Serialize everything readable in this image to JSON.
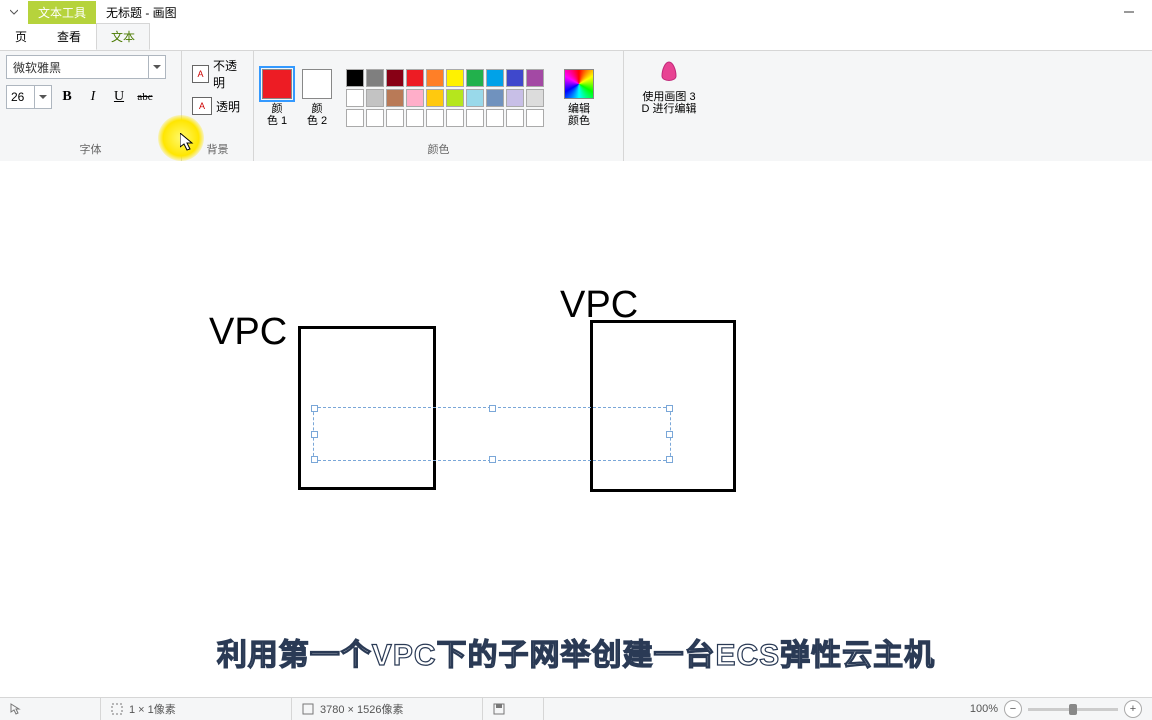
{
  "title": {
    "context_tab": "文本工具",
    "doc": "无标题 - 画图"
  },
  "tabs": {
    "home": "页",
    "view": "查看",
    "text": "文本"
  },
  "font": {
    "family": "微软雅黑",
    "size": "26",
    "bold": "B",
    "italic": "I",
    "underline": "U",
    "strike": "abc",
    "group_label": "字体"
  },
  "background": {
    "opaque": "不透明",
    "transparent": "透明",
    "group_label": "背景"
  },
  "colors": {
    "color1_label_a": "颜",
    "color1_label_b": "色 1",
    "color2_label_a": "颜",
    "color2_label_b": "色 2",
    "color1_value": "#ed1c24",
    "color2_value": "#ffffff",
    "edit_label_a": "编辑",
    "edit_label_b": "颜色",
    "group_label": "颜色",
    "palette": {
      "row1": [
        "#000000",
        "#7f7f7f",
        "#880015",
        "#ed1c24",
        "#ff7f27",
        "#fff200",
        "#22b14c",
        "#00a2e8",
        "#3f48cc",
        "#a349a4"
      ],
      "row2": [
        "#ffffff",
        "#c3c3c3",
        "#b97a57",
        "#ffaec9",
        "#ffc90e",
        "#b5e61d",
        "#99d9ea",
        "#7092be",
        "#c8bfe7",
        "#dcdcdc"
      ],
      "row3": [
        "",
        "",
        "",
        "",
        "",
        "",
        "",
        "",
        "",
        ""
      ]
    }
  },
  "paint3d": {
    "line1": "使用画图 3",
    "line2": "D 进行编辑"
  },
  "canvas": {
    "text1": "VPC",
    "text2": "VPC",
    "caption": "利用第一个VPC下的子网举创建一台ECS弹性云主机"
  },
  "status": {
    "cursor_dim": "1 × 1像素",
    "canvas_dim": "3780 × 1526像素",
    "zoom": "100%"
  }
}
